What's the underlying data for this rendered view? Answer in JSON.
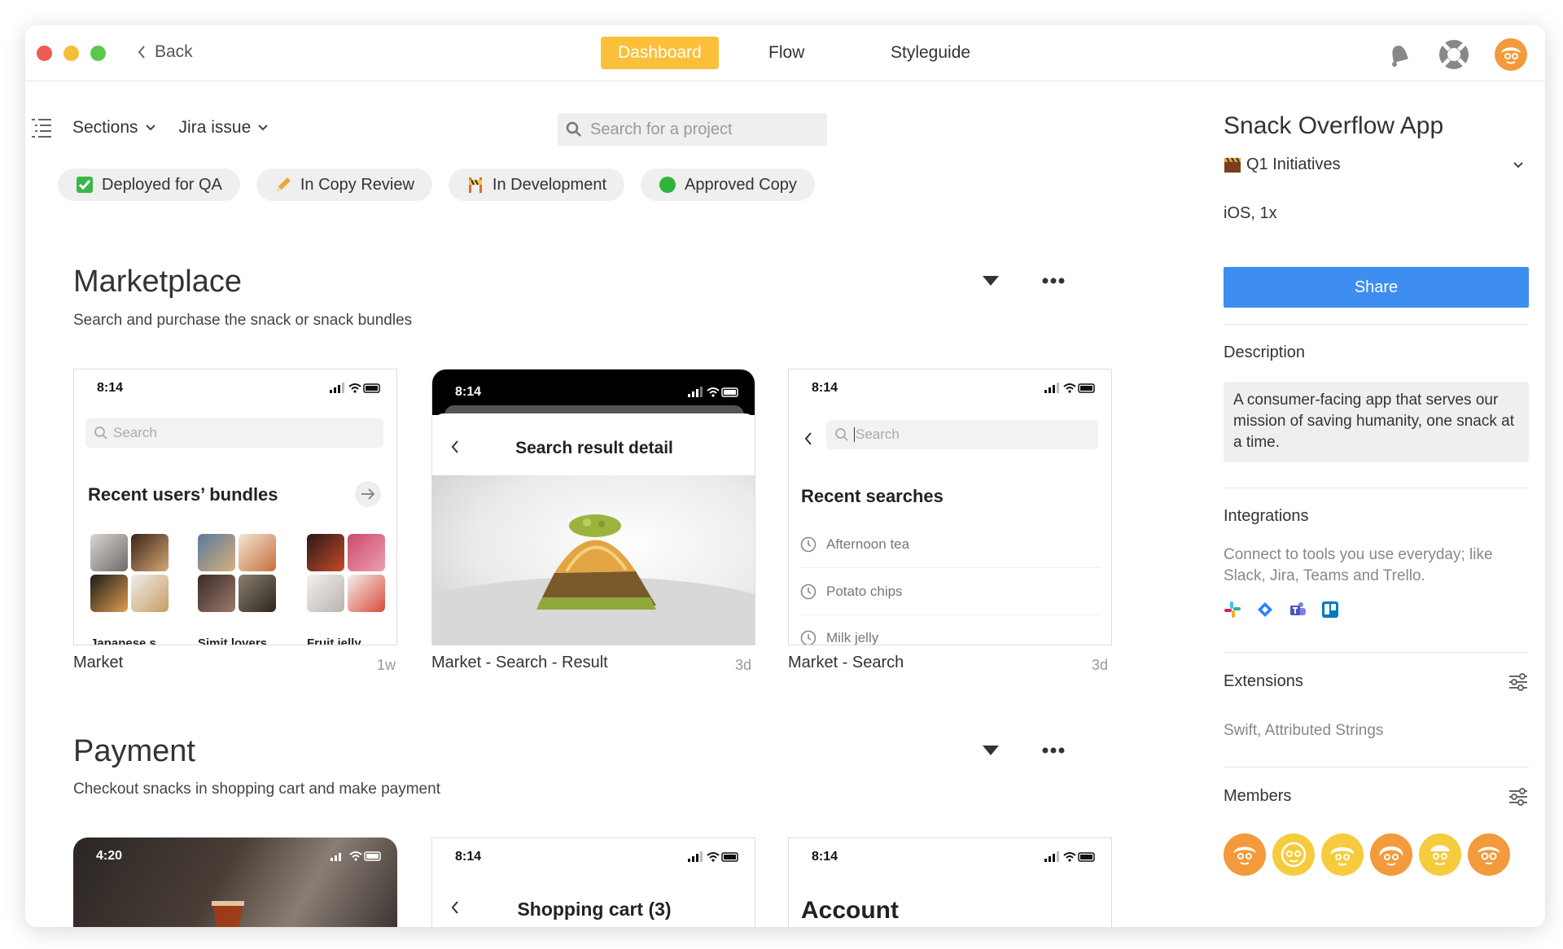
{
  "window": {
    "traffic_colors": [
      "#ee5b52",
      "#f6bd3c",
      "#5ac94a"
    ]
  },
  "header": {
    "back_label": "Back",
    "tabs": [
      {
        "label": "Dashboard",
        "active": true
      },
      {
        "label": "Flow",
        "active": false
      },
      {
        "label": "Styleguide",
        "active": false
      }
    ],
    "icons": [
      "bell-icon",
      "lifebuoy-icon",
      "user-avatar-icon"
    ]
  },
  "toolbar": {
    "sections_label": "Sections",
    "jira_label": "Jira issue",
    "search_placeholder": "Search for a project"
  },
  "filters": [
    {
      "label": "Deployed for QA",
      "icon": "check-box-icon",
      "color": "#3bb54a"
    },
    {
      "label": "In Copy Review",
      "icon": "pencil-icon",
      "color": "#f2a33a"
    },
    {
      "label": "In Development",
      "icon": "construction-icon",
      "color": "#e46a2e"
    },
    {
      "label": "Approved Copy",
      "icon": "green-circle-icon",
      "color": "#2cb53a"
    }
  ],
  "sections": [
    {
      "title": "Marketplace",
      "description": "Search and purchase the snack or snack bundles",
      "screens": [
        {
          "caption": "Market",
          "age": "1w",
          "time": "8:14",
          "search_placeholder": "Search",
          "heading": "Recent users’ bundles",
          "bundles": [
            "Japanese s...",
            "Simit lovers",
            "Fruit jelly..."
          ]
        },
        {
          "caption": "Market - Search - Result",
          "age": "3d",
          "time": "8:14",
          "heading": "Search result detail"
        },
        {
          "caption": "Market - Search",
          "age": "3d",
          "time": "8:14",
          "search_placeholder": "Search",
          "heading": "Recent searches",
          "items": [
            "Afternoon tea",
            "Potato chips",
            "Milk jelly"
          ]
        }
      ]
    },
    {
      "title": "Payment",
      "description": "Checkout snacks in shopping cart and make payment",
      "screens": [
        {
          "time": "4:20"
        },
        {
          "time": "8:14",
          "heading": "Shopping cart (3)"
        },
        {
          "time": "8:14",
          "heading": "Account"
        }
      ]
    }
  ],
  "details": {
    "title": "Snack Overflow App",
    "initiative": "Q1 Initiatives",
    "platform": "iOS, 1x",
    "share_label": "Share",
    "description_heading": "Description",
    "description": "A consumer-facing app that serves our mission of saving humanity, one snack at a time.",
    "integrations_heading": "Integrations",
    "integrations_text": "Connect to tools you use everyday; like Slack, Jira, Teams and Trello.",
    "integration_icons": [
      "slack-icon",
      "jira-icon",
      "teams-icon",
      "trello-icon"
    ],
    "extensions_heading": "Extensions",
    "extensions_text": "Swift, Attributed Strings",
    "members_heading": "Members",
    "member_colors": [
      "#f39a3c",
      "#f6cb3d",
      "#f6cb3d",
      "#f39a3c",
      "#f6cb3d",
      "#f39a3c"
    ]
  },
  "colors": {
    "accent": "#fbbf3a",
    "share": "#3d8ef0"
  }
}
